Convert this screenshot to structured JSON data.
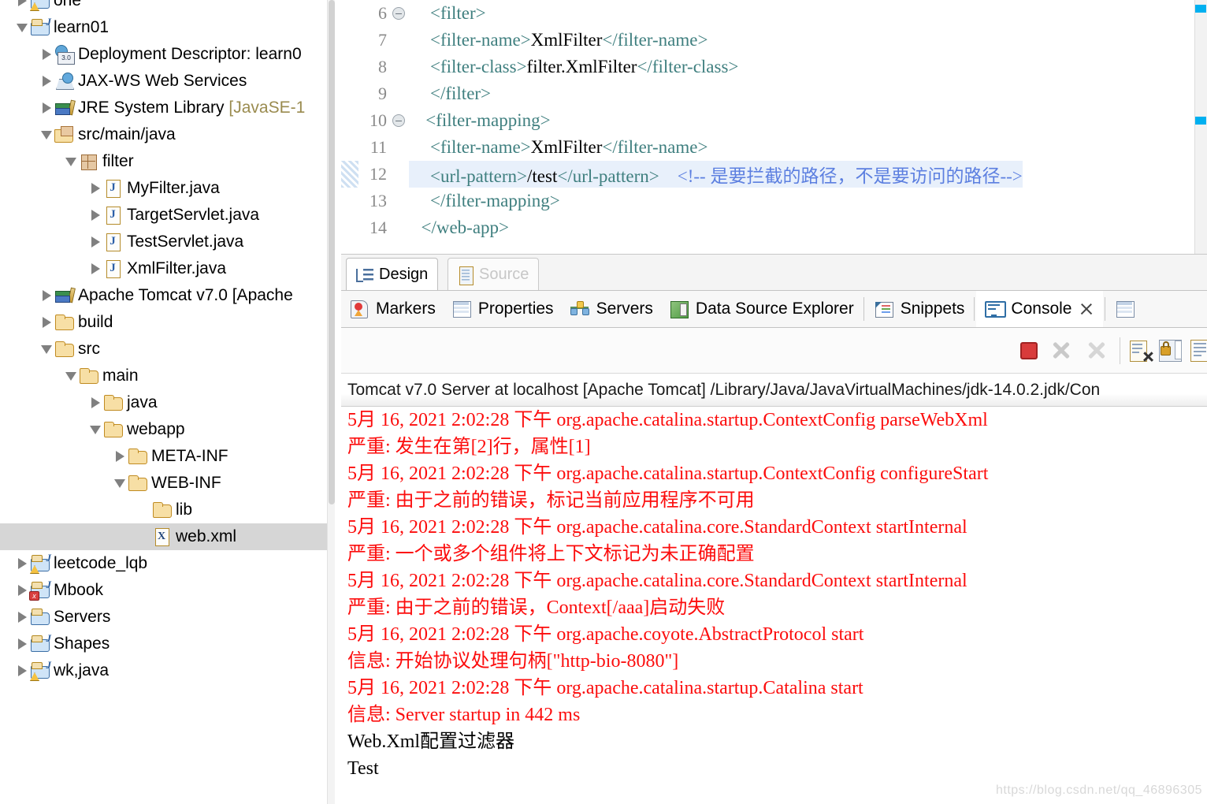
{
  "explorer": {
    "name": "project-explorer",
    "items": [
      {
        "label": "one",
        "icon": "java-project-warning-icon",
        "indent": 0,
        "twisty": "collapsed",
        "clipped": true,
        "selected": false
      },
      {
        "label": "learn01",
        "icon": "java-project-icon",
        "indent": 0,
        "twisty": "expanded",
        "selected": false
      },
      {
        "label": "Deployment Descriptor: learn0",
        "icon": "deployment-descriptor-icon",
        "indent": 1,
        "twisty": "collapsed",
        "selected": false
      },
      {
        "label": "JAX-WS Web Services",
        "icon": "jax-ws-icon",
        "indent": 1,
        "twisty": "collapsed",
        "selected": false
      },
      {
        "label": "JRE System Library ",
        "suffix": "[JavaSE-1",
        "icon": "library-icon",
        "indent": 1,
        "twisty": "collapsed",
        "selected": false
      },
      {
        "label": "src/main/java",
        "icon": "package-root-icon",
        "indent": 1,
        "twisty": "expanded",
        "selected": false
      },
      {
        "label": "filter",
        "icon": "package-icon",
        "indent": 2,
        "twisty": "expanded",
        "selected": false
      },
      {
        "label": "MyFilter.java",
        "icon": "java-file-icon",
        "indent": 3,
        "twisty": "collapsed",
        "selected": false
      },
      {
        "label": "TargetServlet.java",
        "icon": "java-file-icon",
        "indent": 3,
        "twisty": "collapsed",
        "selected": false
      },
      {
        "label": "TestServlet.java",
        "icon": "java-file-icon",
        "indent": 3,
        "twisty": "collapsed",
        "selected": false
      },
      {
        "label": "XmlFilter.java",
        "icon": "java-file-icon",
        "indent": 3,
        "twisty": "collapsed",
        "selected": false
      },
      {
        "label": "Apache Tomcat v7.0 [Apache ",
        "icon": "library-icon",
        "indent": 1,
        "twisty": "collapsed",
        "selected": false
      },
      {
        "label": "build",
        "icon": "folder-icon",
        "indent": 1,
        "twisty": "collapsed",
        "selected": false
      },
      {
        "label": "src",
        "icon": "folder-icon",
        "indent": 1,
        "twisty": "expanded",
        "selected": false
      },
      {
        "label": "main",
        "icon": "folder-icon",
        "indent": 2,
        "twisty": "expanded",
        "selected": false
      },
      {
        "label": "java",
        "icon": "folder-icon",
        "indent": 3,
        "twisty": "collapsed",
        "selected": false
      },
      {
        "label": "webapp",
        "icon": "folder-icon",
        "indent": 3,
        "twisty": "expanded",
        "selected": false
      },
      {
        "label": "META-INF",
        "icon": "folder-icon",
        "indent": 4,
        "twisty": "collapsed",
        "selected": false
      },
      {
        "label": "WEB-INF",
        "icon": "folder-icon",
        "indent": 4,
        "twisty": "expanded",
        "selected": false
      },
      {
        "label": "lib",
        "icon": "folder-icon",
        "indent": 5,
        "twisty": "none",
        "selected": false
      },
      {
        "label": "web.xml",
        "icon": "xml-file-icon",
        "indent": 5,
        "twisty": "none",
        "selected": true
      },
      {
        "label": "leetcode_lqb",
        "icon": "java-project-warning-icon",
        "indent": 0,
        "twisty": "collapsed",
        "selected": false
      },
      {
        "label": "Mbook",
        "icon": "java-project-error-icon",
        "indent": 0,
        "twisty": "collapsed",
        "selected": false
      },
      {
        "label": "Servers",
        "icon": "project-folder-icon",
        "indent": 0,
        "twisty": "collapsed",
        "selected": false
      },
      {
        "label": "Shapes",
        "icon": "java-project-icon",
        "indent": 0,
        "twisty": "collapsed",
        "selected": false
      },
      {
        "label": "wk,java",
        "icon": "java-project-warning-icon",
        "indent": 0,
        "twisty": "collapsed",
        "selected": false
      }
    ]
  },
  "editor": {
    "lines": [
      {
        "no": "6",
        "fold": true,
        "current": false,
        "parts": [
          {
            "t": "tag",
            "v": "    <filter>"
          }
        ]
      },
      {
        "no": "7",
        "fold": false,
        "current": false,
        "parts": [
          {
            "t": "tag",
            "v": "    <filter-name>"
          },
          {
            "t": "txt",
            "v": "XmlFilter"
          },
          {
            "t": "tag",
            "v": "</filter-name>"
          }
        ]
      },
      {
        "no": "8",
        "fold": false,
        "current": false,
        "parts": [
          {
            "t": "tag",
            "v": "    <filter-class>"
          },
          {
            "t": "txt",
            "v": "filter.XmlFilter"
          },
          {
            "t": "tag",
            "v": "</filter-class>"
          }
        ]
      },
      {
        "no": "9",
        "fold": false,
        "current": false,
        "parts": [
          {
            "t": "tag",
            "v": "    </filter>"
          }
        ]
      },
      {
        "no": "10",
        "fold": true,
        "current": false,
        "parts": [
          {
            "t": "tag",
            "v": "   <filter-mapping>"
          }
        ]
      },
      {
        "no": "11",
        "fold": false,
        "current": false,
        "parts": [
          {
            "t": "tag",
            "v": "    <filter-name>"
          },
          {
            "t": "txt",
            "v": "XmlFilter"
          },
          {
            "t": "tag",
            "v": "</filter-name>"
          }
        ]
      },
      {
        "no": "12",
        "fold": false,
        "current": true,
        "quickdiff": true,
        "parts": [
          {
            "t": "tag",
            "v": "    <url-pattern>"
          },
          {
            "t": "txt",
            "v": "/test"
          },
          {
            "t": "tag",
            "v": "</url-pattern>"
          },
          {
            "t": "txt",
            "v": "    "
          },
          {
            "t": "cmt",
            "v": "<!-- 是要拦截的路径，不是要访问的路径-->"
          }
        ]
      },
      {
        "no": "13",
        "fold": false,
        "current": false,
        "parts": [
          {
            "t": "tag",
            "v": "    </filter-mapping>"
          }
        ]
      },
      {
        "no": "14",
        "fold": false,
        "current": false,
        "parts": [
          {
            "t": "tag",
            "v": "  </web-app>"
          }
        ]
      }
    ],
    "tabs": [
      {
        "label": "Design",
        "icon": "design-view-icon",
        "active": true
      },
      {
        "label": "Source",
        "icon": "source-file-icon",
        "active": false
      }
    ]
  },
  "views": {
    "tabs": [
      {
        "label": "Markers",
        "icon": "markers-icon",
        "active": false
      },
      {
        "label": "Properties",
        "icon": "properties-icon",
        "active": false
      },
      {
        "label": "Servers",
        "icon": "servers-icon",
        "active": false
      },
      {
        "label": "Data Source Explorer",
        "icon": "data-source-explorer-icon",
        "active": false
      },
      {
        "label": "Snippets",
        "icon": "snippets-icon",
        "active": false
      },
      {
        "label": "Console",
        "icon": "console-icon",
        "active": true
      }
    ]
  },
  "console": {
    "toolbar": [
      {
        "name": "terminate-button",
        "icon": "stop-icon"
      },
      {
        "name": "remove-launch-button",
        "icon": "x-icon"
      },
      {
        "name": "remove-all-launches-button",
        "icon": "double-x-icon"
      },
      {
        "name": "clear-console-button",
        "icon": "clear-console-icon"
      },
      {
        "name": "scroll-lock-button",
        "icon": "lock-icon"
      },
      {
        "name": "pin-console-button",
        "icon": "pin-console-icon"
      }
    ],
    "header": "Tomcat v7.0 Server at localhost [Apache Tomcat] /Library/Java/JavaVirtualMachines/jdk-14.0.2.jdk/Con",
    "clipped_line": "",
    "lines": [
      {
        "type": "err",
        "text": "5月 16, 2021 2:02:28 下午 org.apache.catalina.startup.ContextConfig parseWebXml"
      },
      {
        "type": "err",
        "text": "严重: 发生在第[2]行，属性[1]"
      },
      {
        "type": "err",
        "text": "5月 16, 2021 2:02:28 下午 org.apache.catalina.startup.ContextConfig configureStart"
      },
      {
        "type": "err",
        "text": "严重: 由于之前的错误，标记当前应用程序不可用"
      },
      {
        "type": "err",
        "text": "5月 16, 2021 2:02:28 下午 org.apache.catalina.core.StandardContext startInternal"
      },
      {
        "type": "err",
        "text": "严重: 一个或多个组件将上下文标记为未正确配置"
      },
      {
        "type": "err",
        "text": "5月 16, 2021 2:02:28 下午 org.apache.catalina.core.StandardContext startInternal"
      },
      {
        "type": "err",
        "text": "严重: 由于之前的错误，Context[/aaa]启动失败"
      },
      {
        "type": "err",
        "text": "5月 16, 2021 2:02:28 下午 org.apache.coyote.AbstractProtocol start"
      },
      {
        "type": "err",
        "text": "信息: 开始协议处理句柄[\"http-bio-8080\"]"
      },
      {
        "type": "err",
        "text": "5月 16, 2021 2:02:28 下午 org.apache.catalina.startup.Catalina start"
      },
      {
        "type": "err",
        "text": "信息: Server startup in 442 ms"
      },
      {
        "type": "out",
        "text": "Web.Xml配置过滤器"
      },
      {
        "type": "out",
        "text": "Test"
      }
    ]
  },
  "watermark": "https://blog.csdn.net/qq_46896305",
  "colors": {
    "xml_tag": "#3f7f7f",
    "xml_comment": "#5c7fe0",
    "console_error": "#fc0d0d",
    "console_out": "#000000",
    "selection": "#d6d6d6",
    "current_line": "#e8f0fb",
    "annotation_marker": "#00b0f0"
  }
}
